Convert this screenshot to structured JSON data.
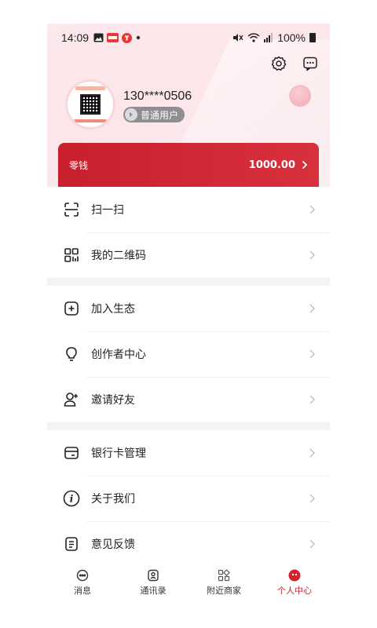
{
  "status_bar": {
    "time": "14:09",
    "battery": "100%"
  },
  "profile": {
    "phone": "130****0506",
    "level": "普通用户"
  },
  "wallet": {
    "label": "零钱",
    "amount": "1000.00"
  },
  "menu": {
    "group1": [
      {
        "label": "扫一扫",
        "icon": "scan-icon"
      },
      {
        "label": "我的二维码",
        "icon": "qrcode-icon"
      }
    ],
    "group2": [
      {
        "label": "加入生态",
        "icon": "plus-square-icon"
      },
      {
        "label": "创作者中心",
        "icon": "lightbulb-icon"
      },
      {
        "label": "邀请好友",
        "icon": "add-friend-icon"
      }
    ],
    "group3": [
      {
        "label": "银行卡管理",
        "icon": "bank-card-icon"
      },
      {
        "label": "关于我们",
        "icon": "info-icon"
      },
      {
        "label": "意见反馈",
        "icon": "feedback-icon"
      }
    ]
  },
  "tabbar": [
    {
      "label": "消息",
      "icon": "message-icon"
    },
    {
      "label": "通讯录",
      "icon": "contacts-icon"
    },
    {
      "label": "附近商家",
      "icon": "nearby-shops-icon"
    },
    {
      "label": "个人中心",
      "icon": "profile-icon",
      "active": true
    }
  ],
  "colors": {
    "accent": "#d6202f",
    "wallet_start": "#c81f2e",
    "wallet_end": "#d8303d"
  }
}
